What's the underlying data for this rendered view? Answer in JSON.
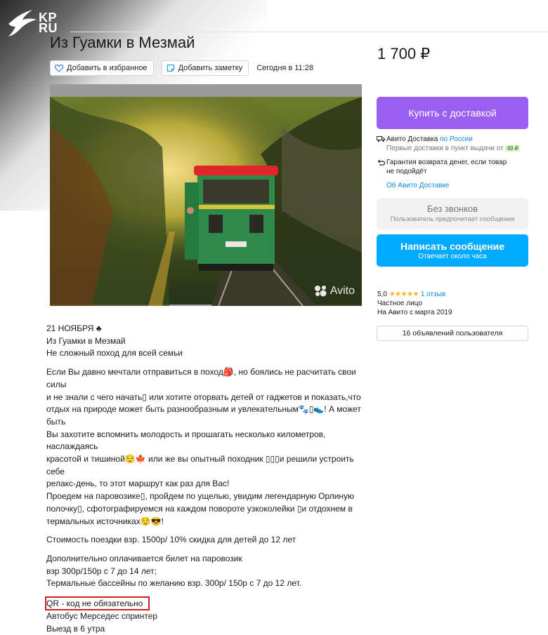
{
  "logo": {
    "text_line1": "KP",
    "text_line2": "RU"
  },
  "header": {
    "title": "Из Гуамки в Мезмай",
    "price": "1 700 ₽",
    "favorite_label": "Добавить в избранное",
    "note_label": "Добавить заметку",
    "date": "Сегодня в 11:28"
  },
  "photo": {
    "watermark": "Avito"
  },
  "sidebar": {
    "buy_label": "Купить с доставкой",
    "delivery_prefix": "Авито Доставка",
    "delivery_link": "по России",
    "delivery_note": "Первые доставки в пункт выдачи от",
    "delivery_price": "49 ₽",
    "guarantee": "Гарантия возврата денег, если товар не подойдёт",
    "about_link": "Об Авито Доставке",
    "no_calls_title": "Без звонков",
    "no_calls_sub": "Пользователь предпочитает сообщения",
    "message_label": "Написать сообщение",
    "message_sub": "Отвечает около часа",
    "rating": "5,0",
    "stars": "★★★★★",
    "reviews": "1 отзыв",
    "seller_type": "Частное лицо",
    "since": "На Авито с марта 2019",
    "ads_button": "16 объявлений пользователя"
  },
  "description": {
    "lines_a": [
      "21 НОЯБРЯ ♣",
      "Из Гуамки в Мезмай",
      "Не сложный поход для всей семьи"
    ],
    "lines_b": [
      "Если Вы давно мечтали отправиться в поход🎒, но боялись не расчитать свои силы",
      "и не знали с чего начать▯ или хотите оторвать детей от гаджетов и показать,что",
      "отдых на природе может быть разнообразным и увлекательным🐾▯👟! А может быть",
      "Вы захотите вспомнить молодость и прошагать несколько километров, наслаждаясь",
      "красотой и тишиной😌🍁 или же вы опытный походник ▯▯▯и решили устроить себе",
      "релакс-день, то этот маршрут как раз для Вас!",
      "Проедем на паровозике▯, пройдем по ущелью, увидим легендарную Орлиную",
      "полочку▯, сфотографируемся на каждом повороте узкоколейки ▯и отдохнем в",
      "термальных источниках😌😎!"
    ],
    "line_c": "Стоимость поездки взр. 1500р/ 10% скидка для детей до 12 лет",
    "lines_d": [
      "Дополнительно оплачивается билет на паровозик",
      "взр 300р/150р с 7 до 14 лет;",
      "Термальные бассейны по желанию взр. 300р/ 150р с 7 до 12 лет."
    ],
    "qr_line": "QR - код не обязательно",
    "lines_e": [
      "Автобус Мерседес спринтер",
      "Выезд в 6 утра"
    ]
  },
  "colors": {
    "buy": "#9a5ff0",
    "message": "#00aaff",
    "link": "#0a8be0",
    "highlight_border": "#d42020"
  }
}
